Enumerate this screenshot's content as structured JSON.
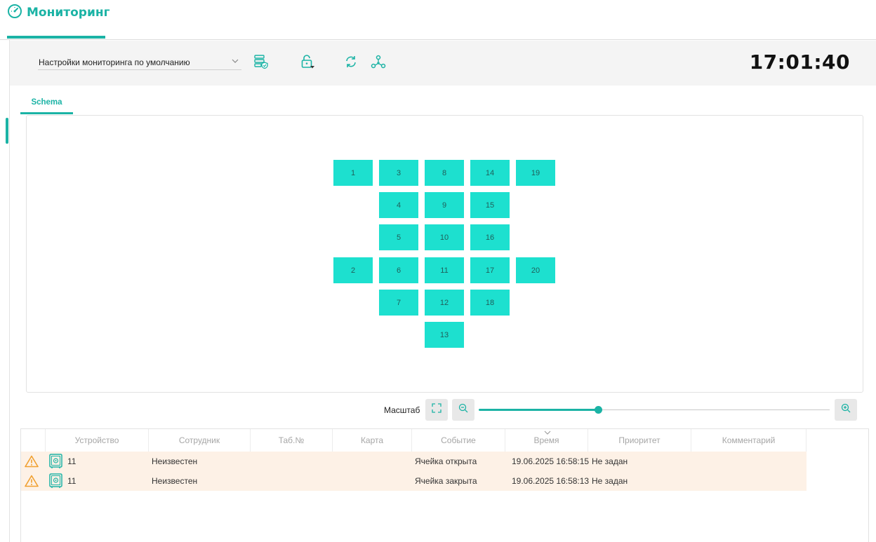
{
  "header": {
    "title": "Мониторинг",
    "icon": "gauge-icon"
  },
  "toolbar": {
    "settings_value": "Настройки мониторинга по умолчанию",
    "clock": "17:01:40",
    "buttons": [
      "config-shield-icon",
      "lock-dropdown-icon",
      "refresh-icon",
      "network-icon"
    ]
  },
  "tabs": [
    {
      "label": "Schema",
      "active": true
    }
  ],
  "schema": {
    "cells": [
      "1",
      "3",
      "8",
      "14",
      "19",
      "4",
      "9",
      "15",
      "5",
      "10",
      "16",
      "2",
      "6",
      "11",
      "17",
      "20",
      "7",
      "12",
      "18",
      "13"
    ]
  },
  "scale": {
    "label": "Масштаб",
    "level": 0.34
  },
  "events": {
    "columns": [
      "Устройство",
      "Сотрудник",
      "Таб.№",
      "Карта",
      "Событие",
      "Время",
      "Приоритет",
      "Комментарий"
    ],
    "sorted_column": "Время",
    "rows": [
      {
        "device": "11",
        "employee": "Неизвестен",
        "tab_no": "",
        "card": "",
        "event": "Ячейка открыта",
        "time": "19.06.2025 16:58:15",
        "priority": "Не задан",
        "comment": ""
      },
      {
        "device": "11",
        "employee": "Неизвестен",
        "tab_no": "",
        "card": "",
        "event": "Ячейка закрыта",
        "time": "19.06.2025 16:58:13",
        "priority": "Не задан",
        "comment": ""
      }
    ]
  },
  "colors": {
    "accent": "#1bb3a5",
    "cell": "#1de0cf",
    "row_highlight": "#fdf1e6",
    "warning": "#f0a030"
  }
}
